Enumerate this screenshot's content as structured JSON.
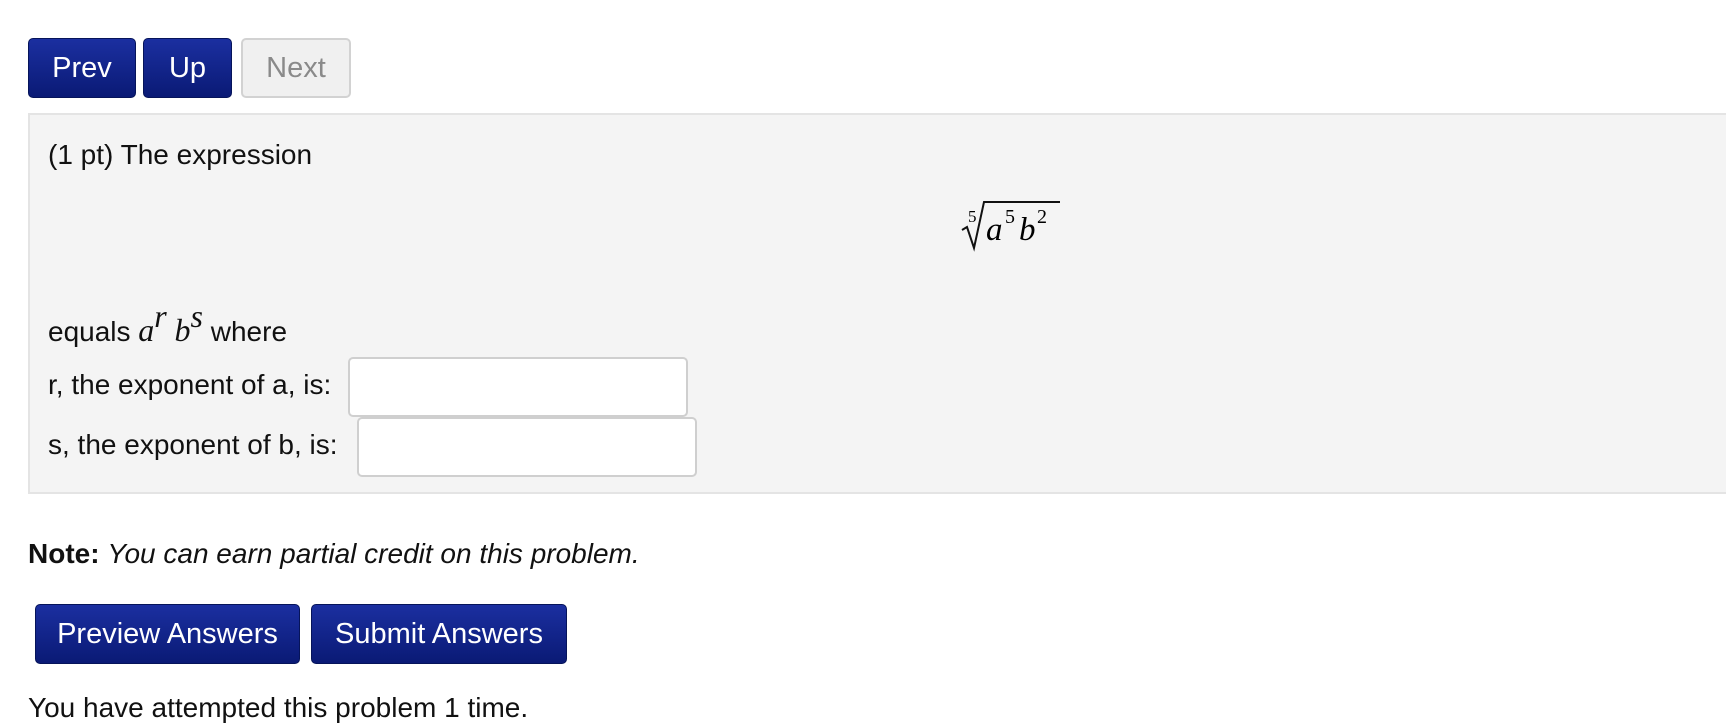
{
  "nav": {
    "prev_label": "Prev",
    "up_label": "Up",
    "next_label": "Next"
  },
  "problem": {
    "intro": "(1 pt) The expression",
    "radical": {
      "index": "5",
      "base1": "a",
      "exp1": "5",
      "base2": "b",
      "exp2": "2"
    },
    "equals_prefix": "equals",
    "equals_expr": {
      "base1": "a",
      "exp1": "r",
      "base2": "b",
      "exp2": "s"
    },
    "equals_suffix": "where",
    "r_label": "r, the exponent of a, is:",
    "r_value": "",
    "s_label": "s, the exponent of b, is:",
    "s_value": ""
  },
  "note": {
    "label": "Note:",
    "text": "You can earn partial credit on this problem."
  },
  "actions": {
    "preview_label": "Preview Answers",
    "submit_label": "Submit Answers"
  },
  "attempts_text": "You have attempted this problem 1 time.",
  "colors": {
    "primary_button": "#0a1a75",
    "disabled_button": "#f0f0f0",
    "panel_background": "#f4f4f4"
  }
}
